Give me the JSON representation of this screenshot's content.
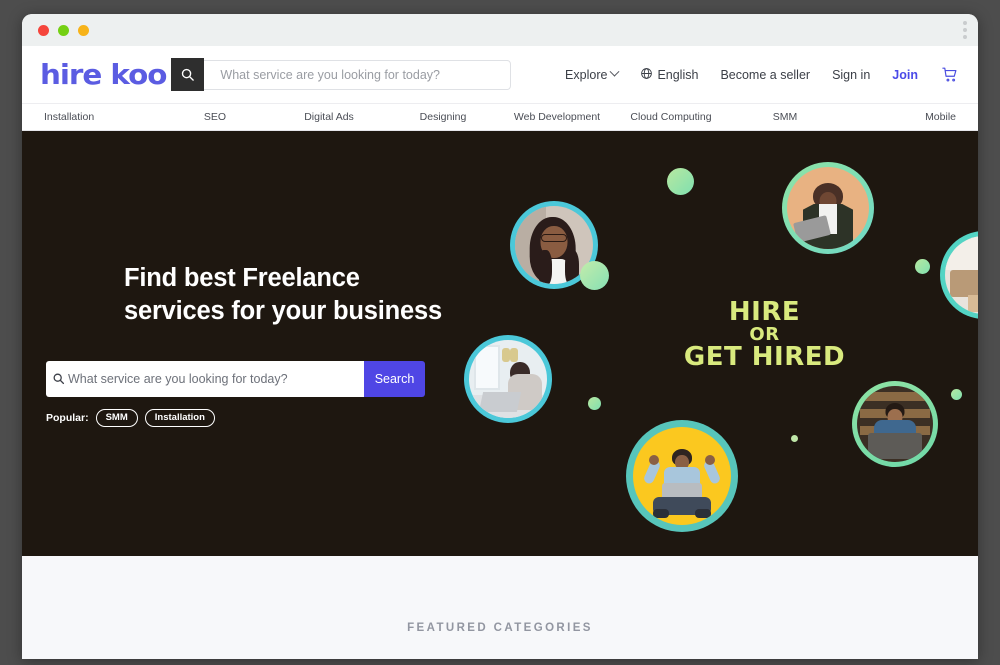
{
  "browser": {
    "traffic_lights": [
      "red",
      "green",
      "yellow"
    ],
    "menu_icon": "kebab-menu-icon"
  },
  "header": {
    "logo_text": "hire koo",
    "search": {
      "placeholder": "What service are you looking for today?",
      "value": "",
      "icon": "search-icon"
    },
    "nav": [
      {
        "label": "Explore",
        "icon": "chevron-down-icon"
      },
      {
        "label": "English",
        "icon": "globe-icon"
      },
      {
        "label": "Become a seller",
        "icon": ""
      },
      {
        "label": "Sign in",
        "icon": ""
      },
      {
        "label": "Join",
        "icon": ""
      }
    ],
    "cart_icon": "shopping-cart-icon"
  },
  "categories": [
    "Installation",
    "SEO",
    "Digital Ads",
    "Designing",
    "Web Development",
    "Cloud Computing",
    "SMM",
    "Mobile"
  ],
  "hero": {
    "background_color": "#1e1710",
    "title": "Find best Freelance\nservices for your business",
    "search": {
      "placeholder": "What service are you looking for today?",
      "value": "",
      "button_label": "Search",
      "button_color": "#4f46e5",
      "icon": "search-icon"
    },
    "popular": {
      "label": "Popular:",
      "tags": [
        "SMM",
        "Installation"
      ]
    },
    "slogan": {
      "line1": "HIRE",
      "line2": "OR",
      "line3": "GET HIRED",
      "color": "#d9ea7e"
    },
    "avatars": [
      {
        "name": "woman-with-glasses",
        "ring_color": "#4bc8d9"
      },
      {
        "name": "man-holding-laptop",
        "ring_color": "#7ddfa0"
      },
      {
        "name": "woman-at-desk",
        "ring_color": "#4bc8d9"
      },
      {
        "name": "man-celebrating",
        "ring_color": "#57c5bb"
      },
      {
        "name": "man-in-library",
        "ring_color": "#7ddfa0"
      },
      {
        "name": "workspace-partial",
        "ring_color": "#53d4c4"
      }
    ]
  },
  "featured": {
    "title": "FEATURED CATEGORIES"
  }
}
